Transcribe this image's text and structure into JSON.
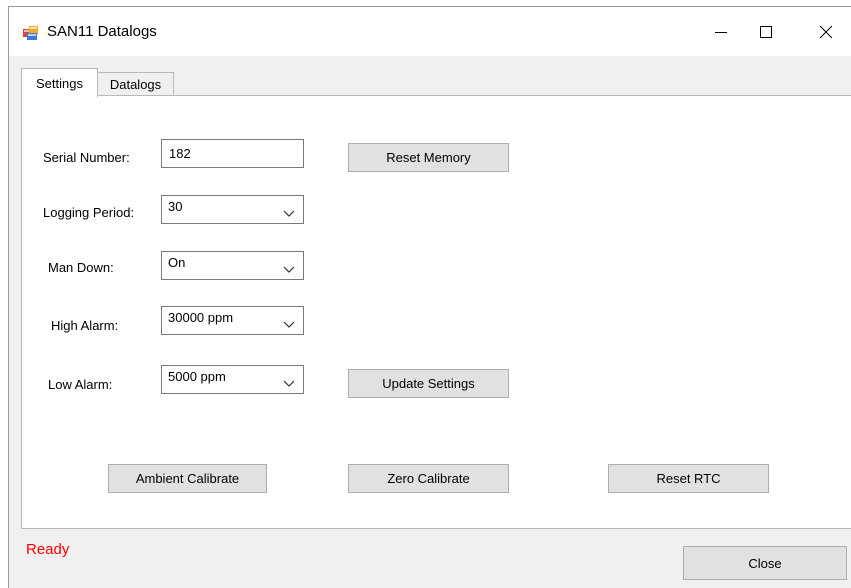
{
  "window": {
    "title": "SAN11 Datalogs",
    "controls": {
      "minimize_icon": "minimize-icon",
      "maximize_icon": "maximize-icon",
      "close_icon": "close-icon"
    }
  },
  "tabs": [
    {
      "label": "Settings",
      "selected": true
    },
    {
      "label": "Datalogs",
      "selected": false
    }
  ],
  "settings": {
    "serial_number": {
      "label": "Serial Number:",
      "value": "182"
    },
    "logging_period": {
      "label": "Logging Period:",
      "value": "30"
    },
    "man_down": {
      "label": "Man Down:",
      "value": "On"
    },
    "high_alarm": {
      "label": "High Alarm:",
      "value": "30000 ppm"
    },
    "low_alarm": {
      "label": "Low Alarm:",
      "value": "5000 ppm"
    }
  },
  "buttons": {
    "reset_memory": "Reset Memory",
    "update_settings": "Update Settings",
    "ambient_calibrate": "Ambient Calibrate",
    "zero_calibrate": "Zero Calibrate",
    "reset_rtc": "Reset RTC",
    "close": "Close"
  },
  "status": {
    "text": "Ready",
    "color": "#ff0000"
  }
}
